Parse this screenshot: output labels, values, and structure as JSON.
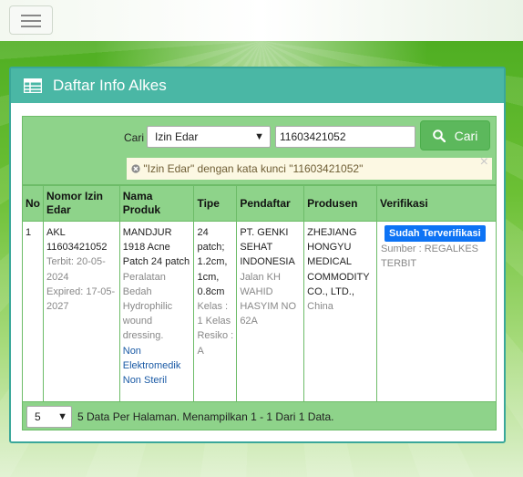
{
  "nav": {
    "menu_icon": "hamburger-icon"
  },
  "panel": {
    "title": "Daftar Info Alkes",
    "icon": "table-icon"
  },
  "search": {
    "label": "Cari",
    "field_selected": "Izin Edar",
    "keyword_value": "11603421052",
    "button_label": "Cari",
    "button_icon": "search-icon",
    "alert_text": "\"Izin Edar\" dengan kata kunci \"11603421052\"",
    "alert_icon": "cancel-circle-icon",
    "alert_close": "×"
  },
  "table": {
    "headers": [
      "No",
      "Nomor Izin Edar",
      "Nama Produk",
      "Tipe",
      "Pendaftar",
      "Produsen",
      "Verifikasi"
    ],
    "rows": [
      {
        "no": "1",
        "izin_main": "AKL 11603421052",
        "izin_terbit": "Terbit: 20-05-2024",
        "izin_expired": "Expired: 17-05-2027",
        "produk_nama": "MANDJUR 1918 Acne Patch 24 patch",
        "produk_desc": "Peralatan Bedah Hydrophilic wound dressing.",
        "produk_kategori": "Non Elektromedik Non Steril",
        "tipe_main": "24 patch; 1.2cm, 1cm, 0.8cm",
        "tipe_kelas": "Kelas : 1 Kelas Resiko : A",
        "pendaftar_nama": "PT. GENKI SEHAT INDONESIA",
        "pendaftar_alamat": "Jalan KH WAHID HASYIM NO 62A",
        "produsen_nama": "ZHEJIANG HONGYU MEDICAL COMMODITY CO., LTD.,",
        "produsen_negara": "China",
        "verifikasi_badge": "Sudah Terverifikasi",
        "verifikasi_sumber": "Sumber : REGALKES TERBIT"
      }
    ]
  },
  "pagination": {
    "per_page": "5",
    "info": "5 Data Per Halaman. Menampilkan 1 - 1 Dari 1 Data."
  }
}
